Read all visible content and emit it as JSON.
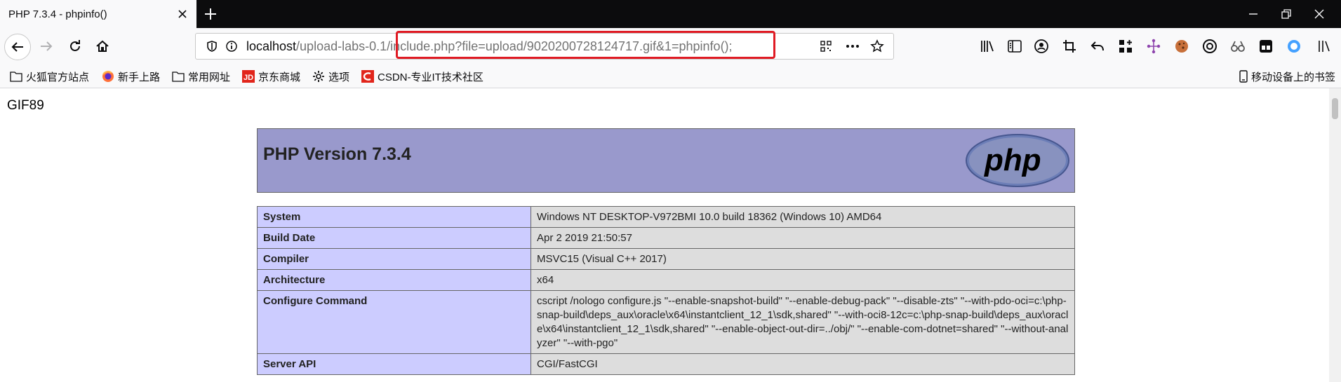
{
  "window": {
    "tab_title": "PHP 7.3.4 - phpinfo()"
  },
  "navbar": {
    "url_host": "localhost",
    "url_path_plain": "/upload-labs-0.1",
    "url_path_rest": "/include.php?file=upload/9020200728124717.gif&1=phpinfo();",
    "highlight_color": "#e01b24"
  },
  "bookmarks": [
    {
      "label": "火狐官方站点",
      "icon": "folder-icon"
    },
    {
      "label": "新手上路",
      "icon": "firefox-icon"
    },
    {
      "label": "常用网址",
      "icon": "folder-icon"
    },
    {
      "label": "京东商城",
      "icon": "jd-icon"
    },
    {
      "label": "选项",
      "icon": "gear-icon"
    },
    {
      "label": "CSDN-专业IT技术社区",
      "icon": "csdn-icon"
    }
  ],
  "mobile_bookmarks": "移动设备上的书签",
  "page": {
    "prefix_text": "GIF89",
    "php_title": "PHP Version 7.3.4",
    "logo_text": "php",
    "rows": [
      {
        "key": "System",
        "value": "Windows NT DESKTOP-V972BMI 10.0 build 18362 (Windows 10) AMD64"
      },
      {
        "key": "Build Date",
        "value": "Apr 2 2019 21:50:57"
      },
      {
        "key": "Compiler",
        "value": "MSVC15 (Visual C++ 2017)"
      },
      {
        "key": "Architecture",
        "value": "x64"
      },
      {
        "key": "Configure Command",
        "value": "cscript /nologo configure.js \"--enable-snapshot-build\" \"--enable-debug-pack\" \"--disable-zts\" \"--with-pdo-oci=c:\\php-snap-build\\deps_aux\\oracle\\x64\\instantclient_12_1\\sdk,shared\" \"--with-oci8-12c=c:\\php-snap-build\\deps_aux\\oracle\\x64\\instantclient_12_1\\sdk,shared\" \"--enable-object-out-dir=../obj/\" \"--enable-com-dotnet=shared\" \"--without-analyzer\" \"--with-pgo\""
      },
      {
        "key": "Server API",
        "value": "CGI/FastCGI"
      }
    ]
  },
  "colors": {
    "header_bg": "#9999cc",
    "key_bg": "#ccccff",
    "value_bg": "#dddddd"
  }
}
